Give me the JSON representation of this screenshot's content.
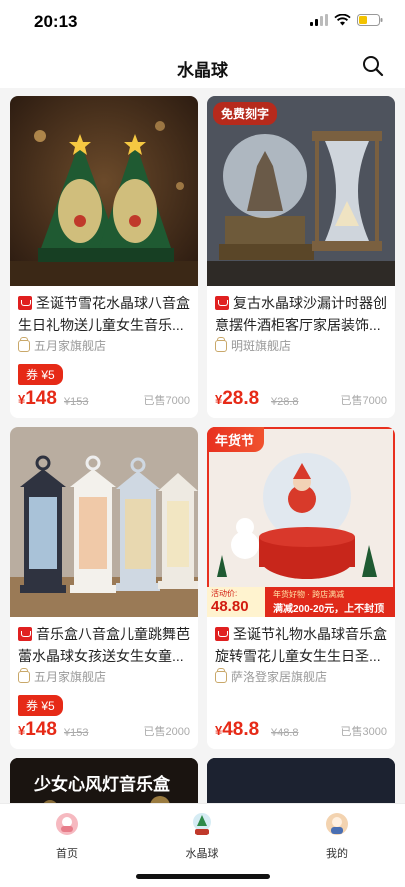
{
  "status": {
    "time": "20:13"
  },
  "nav": {
    "title": "水晶球",
    "search_icon": "search-icon"
  },
  "products": [
    {
      "title": "圣诞节雪花水晶球八音盒生日礼物送儿童女生音乐...",
      "shop": "五月家旗舰店",
      "coupon": "券 ¥5",
      "price_symbol": "¥",
      "price": "148",
      "original_price": "¥153",
      "sold": "已售7000"
    },
    {
      "title": "复古水晶球沙漏计时器创意摆件酒柜客厅家居装饰...",
      "shop": "明斑旗舰店",
      "badge": "免费刻字",
      "price_symbol": "¥",
      "price": "28.8",
      "original_price": "¥28.8",
      "sold": "已售7000"
    },
    {
      "title": "音乐盒八音盒儿童跳舞芭蕾水晶球女孩送女生女童...",
      "shop": "五月家旗舰店",
      "coupon": "券 ¥5",
      "price_symbol": "¥",
      "price": "148",
      "original_price": "¥153",
      "sold": "已售2000"
    },
    {
      "title": "圣诞节礼物水晶球音乐盒旋转雪花儿童女生生日圣...",
      "shop": "萨洛登家居旗舰店",
      "corner_badge": "年货节",
      "promo_label": "活动价:",
      "promo_price": "48.80",
      "promo_top": "年货好物 · 跨店满减",
      "promo_main": "满减200-20元，上不封顶",
      "price_symbol": "¥",
      "price": "48.8",
      "original_price": "¥48.8",
      "sold": "已售3000"
    }
  ],
  "partial_card": {
    "title": "少女心风灯音乐盒"
  },
  "tabs": [
    {
      "label": "首页"
    },
    {
      "label": "水晶球"
    },
    {
      "label": "我的"
    }
  ]
}
